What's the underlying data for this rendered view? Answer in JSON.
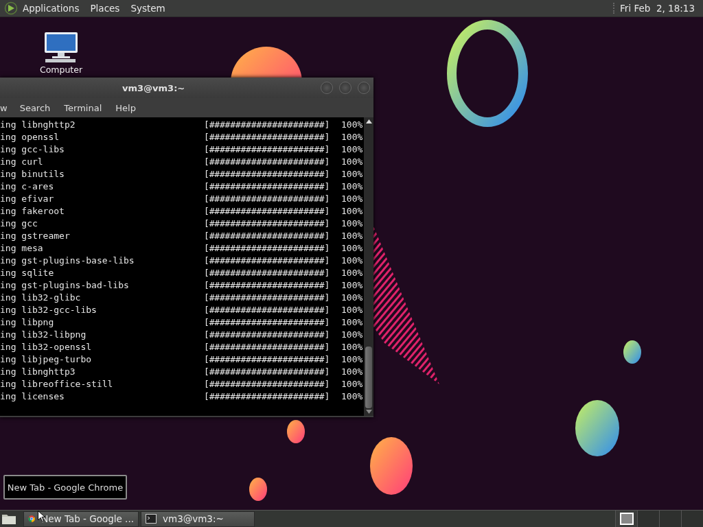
{
  "top_panel": {
    "menus": [
      "Applications",
      "Places",
      "System"
    ],
    "clock": "Fri Feb  2, 18:13"
  },
  "desktop_icons": [
    {
      "label": "Computer"
    }
  ],
  "terminal": {
    "title": "vm3@vm3:~",
    "menus": [
      "w",
      "Search",
      "Terminal",
      "Help"
    ],
    "lines": [
      {
        "text": "ing libnghttp2",
        "bar": "[######################]",
        "percent": "100%"
      },
      {
        "text": "ing openssl",
        "bar": "[######################]",
        "percent": "100%"
      },
      {
        "text": "ing gcc-libs",
        "bar": "[######################]",
        "percent": "100%"
      },
      {
        "text": "ing curl",
        "bar": "[######################]",
        "percent": "100%"
      },
      {
        "text": "ing binutils",
        "bar": "[######################]",
        "percent": "100%"
      },
      {
        "text": "ing c-ares",
        "bar": "[######################]",
        "percent": "100%"
      },
      {
        "text": "ing efivar",
        "bar": "[######################]",
        "percent": "100%"
      },
      {
        "text": "ing fakeroot",
        "bar": "[######################]",
        "percent": "100%"
      },
      {
        "text": "ing gcc",
        "bar": "[######################]",
        "percent": "100%"
      },
      {
        "text": "ing gstreamer",
        "bar": "[######################]",
        "percent": "100%"
      },
      {
        "text": "ing mesa",
        "bar": "[######################]",
        "percent": "100%"
      },
      {
        "text": "ing gst-plugins-base-libs",
        "bar": "[######################]",
        "percent": "100%"
      },
      {
        "text": "ing sqlite",
        "bar": "[######################]",
        "percent": "100%"
      },
      {
        "text": "ing gst-plugins-bad-libs",
        "bar": "[######################]",
        "percent": "100%"
      },
      {
        "text": "ing lib32-glibc",
        "bar": "[######################]",
        "percent": "100%"
      },
      {
        "text": "ing lib32-gcc-libs",
        "bar": "[######################]",
        "percent": "100%"
      },
      {
        "text": "ing libpng",
        "bar": "[######################]",
        "percent": "100%"
      },
      {
        "text": "ing lib32-libpng",
        "bar": "[######################]",
        "percent": "100%"
      },
      {
        "text": "ing lib32-openssl",
        "bar": "[######################]",
        "percent": "100%"
      },
      {
        "text": "ing libjpeg-turbo",
        "bar": "[######################]",
        "percent": "100%"
      },
      {
        "text": "ing libnghttp3",
        "bar": "[######################]",
        "percent": "100%"
      },
      {
        "text": "ing libreoffice-still",
        "bar": "[######################]",
        "percent": "100%"
      },
      {
        "text": "ing licenses",
        "bar": "[######################]",
        "percent": "100%"
      }
    ]
  },
  "tooltip": "New Tab - Google Chrome",
  "taskbar": {
    "items": [
      {
        "kind": "browser",
        "label": "New Tab - Google ...",
        "selected": false
      },
      {
        "kind": "terminal",
        "label": "vm3@vm3:~",
        "selected": false
      }
    ],
    "workspaces": [
      {
        "selected": true
      },
      {
        "selected": false
      },
      {
        "selected": false
      },
      {
        "selected": false
      }
    ]
  }
}
